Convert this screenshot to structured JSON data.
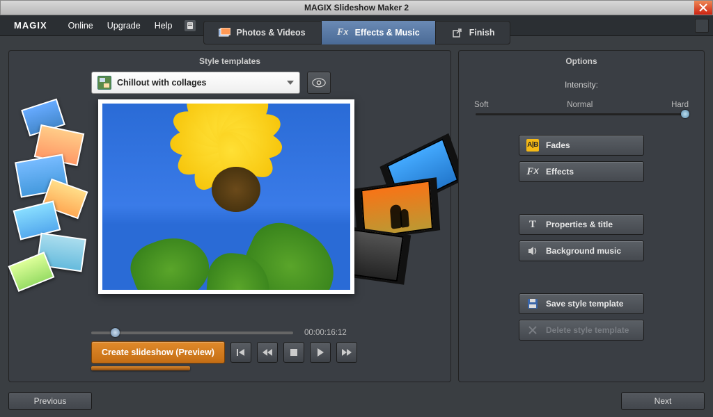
{
  "window": {
    "title": "MAGIX Slideshow Maker 2"
  },
  "menubar": {
    "logo": "MAGIX",
    "items": [
      "Online",
      "Upgrade",
      "Help"
    ]
  },
  "tabs": [
    {
      "label": "Photos & Videos",
      "active": false
    },
    {
      "label": "Effects & Music",
      "active": true
    },
    {
      "label": "Finish",
      "active": false
    }
  ],
  "left_panel": {
    "title": "Style templates",
    "template_selected": "Chillout with collages",
    "timecode": "00:00:16:12",
    "create_button": "Create slideshow (Preview)"
  },
  "right_panel": {
    "title": "Options",
    "intensity_label": "Intensity:",
    "intensity_ticks": {
      "soft": "Soft",
      "normal": "Normal",
      "hard": "Hard"
    },
    "buttons": {
      "fades": "Fades",
      "effects": "Effects",
      "properties": "Properties & title",
      "bgmusic": "Background music",
      "save_template": "Save style template",
      "delete_template": "Delete style template"
    }
  },
  "nav": {
    "prev": "Previous",
    "next": "Next"
  }
}
